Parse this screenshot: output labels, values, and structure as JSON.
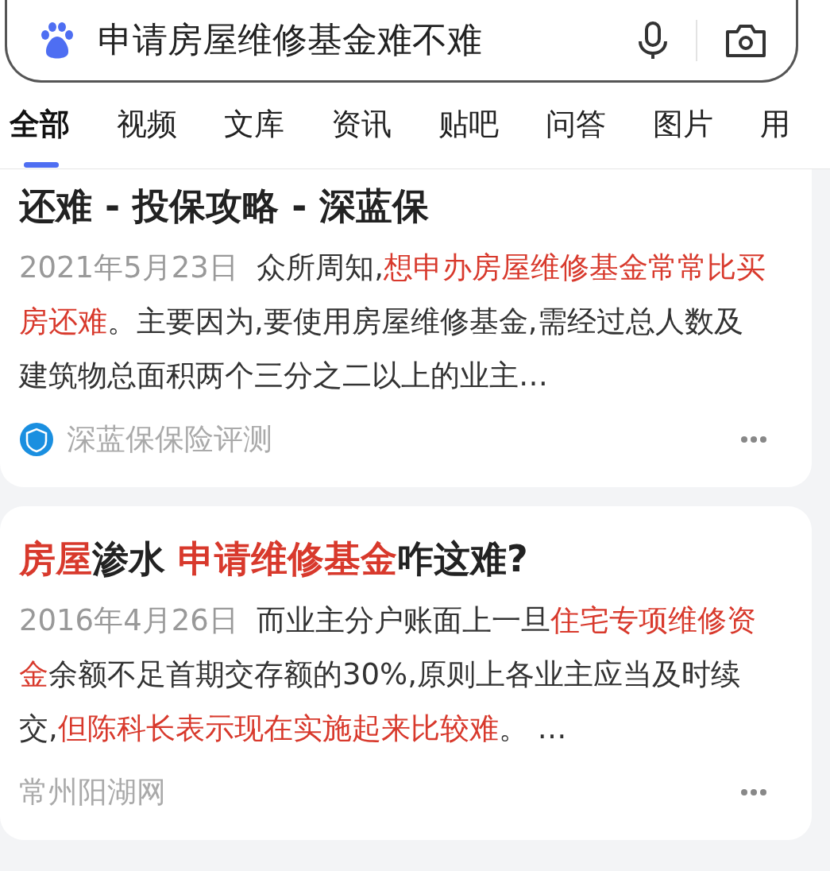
{
  "search": {
    "query": "申请房屋维修基金难不难"
  },
  "tabs": [
    {
      "label": "全部",
      "selected": true
    },
    {
      "label": "视频",
      "selected": false
    },
    {
      "label": "文库",
      "selected": false
    },
    {
      "label": "资讯",
      "selected": false
    },
    {
      "label": "贴吧",
      "selected": false
    },
    {
      "label": "问答",
      "selected": false
    },
    {
      "label": "图片",
      "selected": false
    },
    {
      "label": "用",
      "selected": false
    }
  ],
  "results": [
    {
      "title": [
        {
          "text": "还难 - 投保攻略 - 深蓝保",
          "highlight": false
        }
      ],
      "date": "2021年5月23日",
      "snippet": [
        {
          "text": "众所周知,",
          "highlight": false
        },
        {
          "text": "想申办房屋维修基金常常比买房还难",
          "highlight": true
        },
        {
          "text": "。主要因为,要使用房屋维修基金,需经过总人数及建筑物总面积两个三分之二以上的业主…",
          "highlight": false
        }
      ],
      "source": "深蓝保保险评测",
      "source_logo": true
    },
    {
      "title": [
        {
          "text": "房屋",
          "highlight": true
        },
        {
          "text": "渗水 ",
          "highlight": false
        },
        {
          "text": "申请维修基金",
          "highlight": true
        },
        {
          "text": "咋这难?",
          "highlight": false
        }
      ],
      "date": "2016年4月26日",
      "snippet": [
        {
          "text": "而业主分户账面上一旦",
          "highlight": false
        },
        {
          "text": "住宅专项维修资金",
          "highlight": true
        },
        {
          "text": "余额不足首期交存额的30%,原则上各业主应当及时续交,",
          "highlight": false
        },
        {
          "text": "但陈科长表示现在实施起来比较难",
          "highlight": true
        },
        {
          "text": "。 …",
          "highlight": false
        }
      ],
      "source": "常州阳湖网",
      "source_logo": false
    }
  ]
}
